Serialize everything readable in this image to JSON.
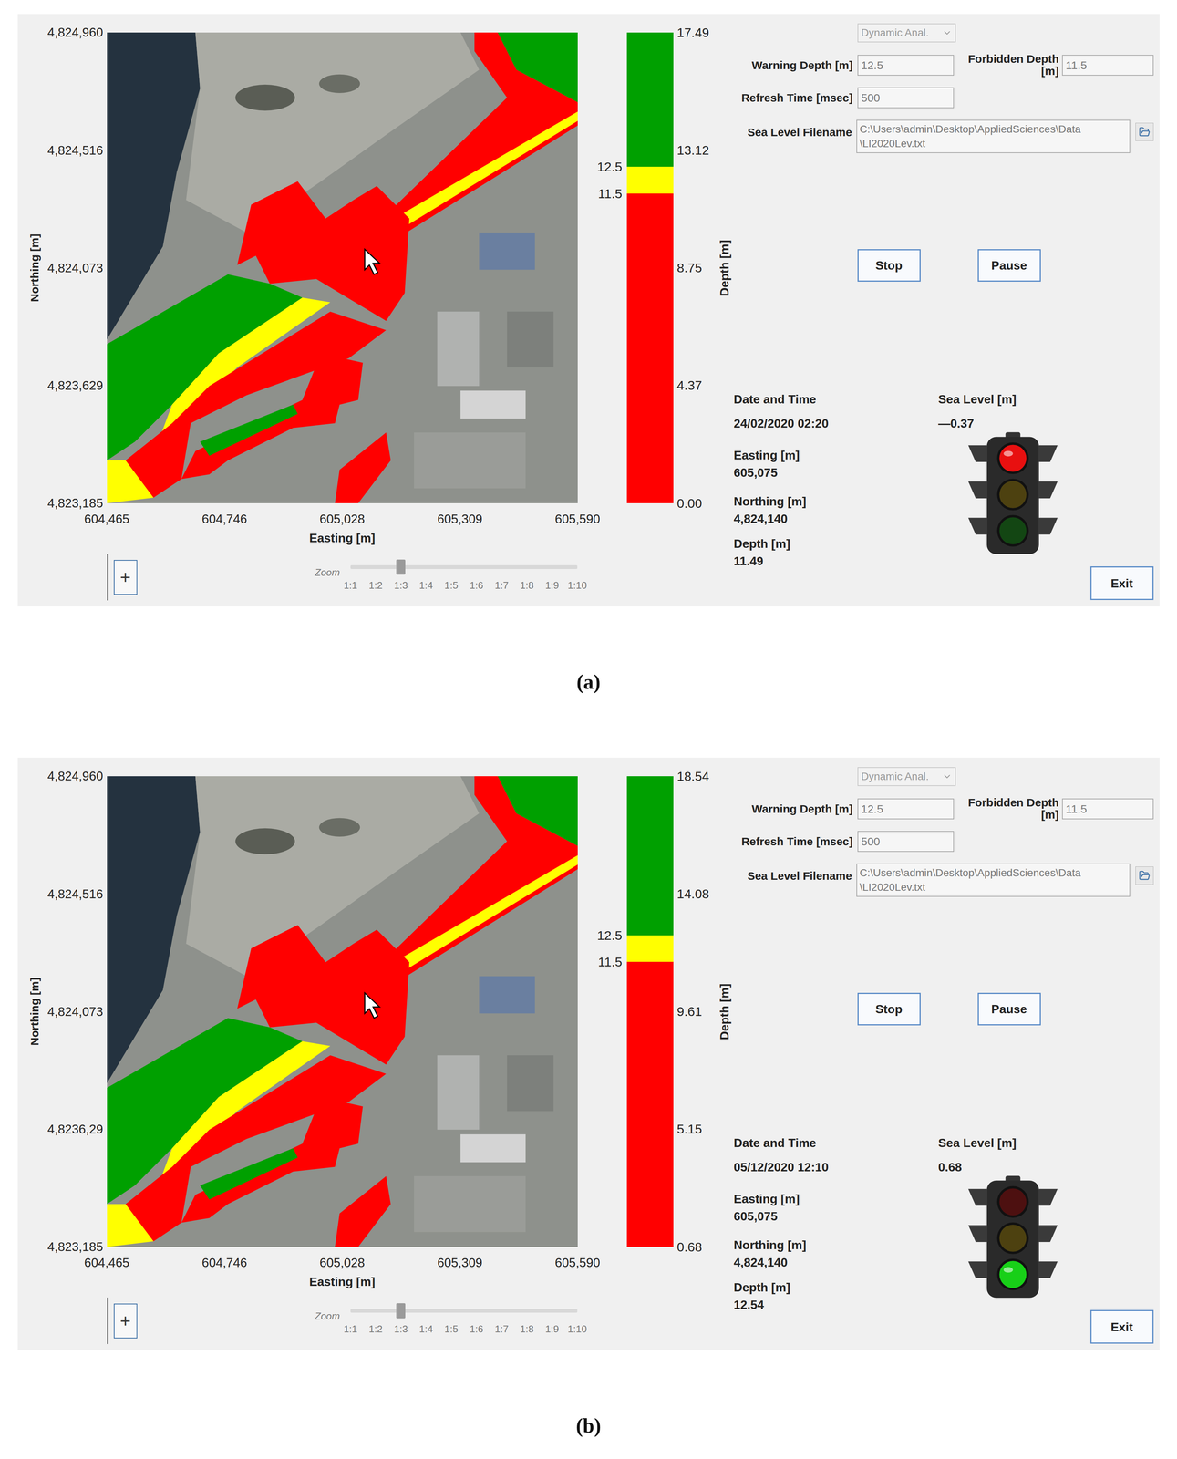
{
  "figures": [
    {
      "caption": "(a)",
      "map": {
        "y_axis_title": "Northing [m]",
        "y_ticks": [
          "4,824,960",
          "4,824,516",
          "4,824,073",
          "4,823,629",
          "4,823,185"
        ],
        "x_axis_title": "Easting [m]",
        "x_ticks": [
          "604,465",
          "604,746",
          "605,028",
          "605,309",
          "605,590"
        ]
      },
      "zoom": {
        "plus": "+",
        "label": "Zoom",
        "ticks": [
          "1:1",
          "1:2",
          "1:3",
          "1:4",
          "1:5",
          "1:6",
          "1:7",
          "1:8",
          "1:9",
          "1:10"
        ],
        "level": 0.222
      },
      "colorbar": {
        "title": "Depth [m]",
        "ticks": [
          "17.49",
          "13.12",
          "8.75",
          "4.37",
          "0.00"
        ],
        "warning": "12.5",
        "forbidden": "11.5",
        "segments": [
          {
            "name": "safe",
            "color": "#00a000"
          },
          {
            "name": "warning",
            "color": "#ffff00"
          },
          {
            "name": "forbidden",
            "color": "#ff0000"
          }
        ]
      },
      "controls": {
        "mode": "Dynamic Anal.",
        "mode_disabled": true,
        "warning_label": "Warning Depth [m]",
        "warning_value": "12.5",
        "forbidden_label": "Forbidden Depth [m]",
        "forbidden_value": "11.5",
        "refresh_label": "Refresh Time [msec]",
        "refresh_value": "500",
        "filename_label": "Sea Level Filename",
        "filename_lines": [
          "C:\\Users\\admin\\Desktop\\AppliedSciences\\Data",
          "\\LI2020Lev.txt"
        ],
        "buttons": [
          "Stop",
          "Pause"
        ],
        "exit": "Exit"
      },
      "readout": {
        "date_label": "Date and Time",
        "date_value": "24/02/2020 02:20",
        "sea_label": "Sea Level [m]",
        "sea_value": "—0.37",
        "easting_label": "Easting [m]",
        "easting_value": "605,075",
        "northing_label": "Northing [m]",
        "northing_value": "4,824,140",
        "depth_label": "Depth [m]",
        "depth_value": "11.49"
      },
      "traffic_light": [
        {
          "name": "red",
          "color": "#e81010",
          "on": true
        },
        {
          "name": "yellow",
          "color": "#e8c010",
          "on": false
        },
        {
          "name": "green",
          "color": "#18d018",
          "on": false
        }
      ]
    },
    {
      "caption": "(b)",
      "map": {
        "y_axis_title": "Northing [m]",
        "y_ticks": [
          "4,824,960",
          "4,824,516",
          "4,824,073",
          "4,8236,29",
          "4,823,185"
        ],
        "x_axis_title": "Easting [m]",
        "x_ticks": [
          "604,465",
          "604,746",
          "605,028",
          "605,309",
          "605,590"
        ]
      },
      "zoom": {
        "plus": "+",
        "label": "Zoom",
        "ticks": [
          "1:1",
          "1:2",
          "1:3",
          "1:4",
          "1:5",
          "1:6",
          "1:7",
          "1:8",
          "1:9",
          "1:10"
        ],
        "level": 0.222
      },
      "colorbar": {
        "title": "Depth [m]",
        "ticks": [
          "18.54",
          "14.08",
          "9.61",
          "5.15",
          "0.68"
        ],
        "warning": "12.5",
        "forbidden": "11.5",
        "segments": [
          {
            "name": "safe",
            "color": "#00a000"
          },
          {
            "name": "warning",
            "color": "#ffff00"
          },
          {
            "name": "forbidden",
            "color": "#ff0000"
          }
        ]
      },
      "controls": {
        "mode": "Dynamic Anal.",
        "mode_disabled": true,
        "warning_label": "Warning Depth [m]",
        "warning_value": "12.5",
        "forbidden_label": "Forbidden Depth [m]",
        "forbidden_value": "11.5",
        "refresh_label": "Refresh Time [msec]",
        "refresh_value": "500",
        "filename_label": "Sea Level Filename",
        "filename_lines": [
          "C:\\Users\\admin\\Desktop\\AppliedSciences\\Data",
          "\\LI2020Lev.txt"
        ],
        "buttons": [
          "Stop",
          "Pause"
        ],
        "exit": "Exit"
      },
      "readout": {
        "date_label": "Date and Time",
        "date_value": "05/12/2020 12:10",
        "sea_label": "Sea Level [m]",
        "sea_value": "0.68",
        "easting_label": "Easting [m]",
        "easting_value": "605,075",
        "northing_label": "Northing [m]",
        "northing_value": "4,824,140",
        "depth_label": "Depth [m]",
        "depth_value": "12.54"
      },
      "traffic_light": [
        {
          "name": "red",
          "color": "#e81010",
          "on": false
        },
        {
          "name": "yellow",
          "color": "#e8c010",
          "on": false
        },
        {
          "name": "green",
          "color": "#18d018",
          "on": true
        }
      ]
    }
  ]
}
